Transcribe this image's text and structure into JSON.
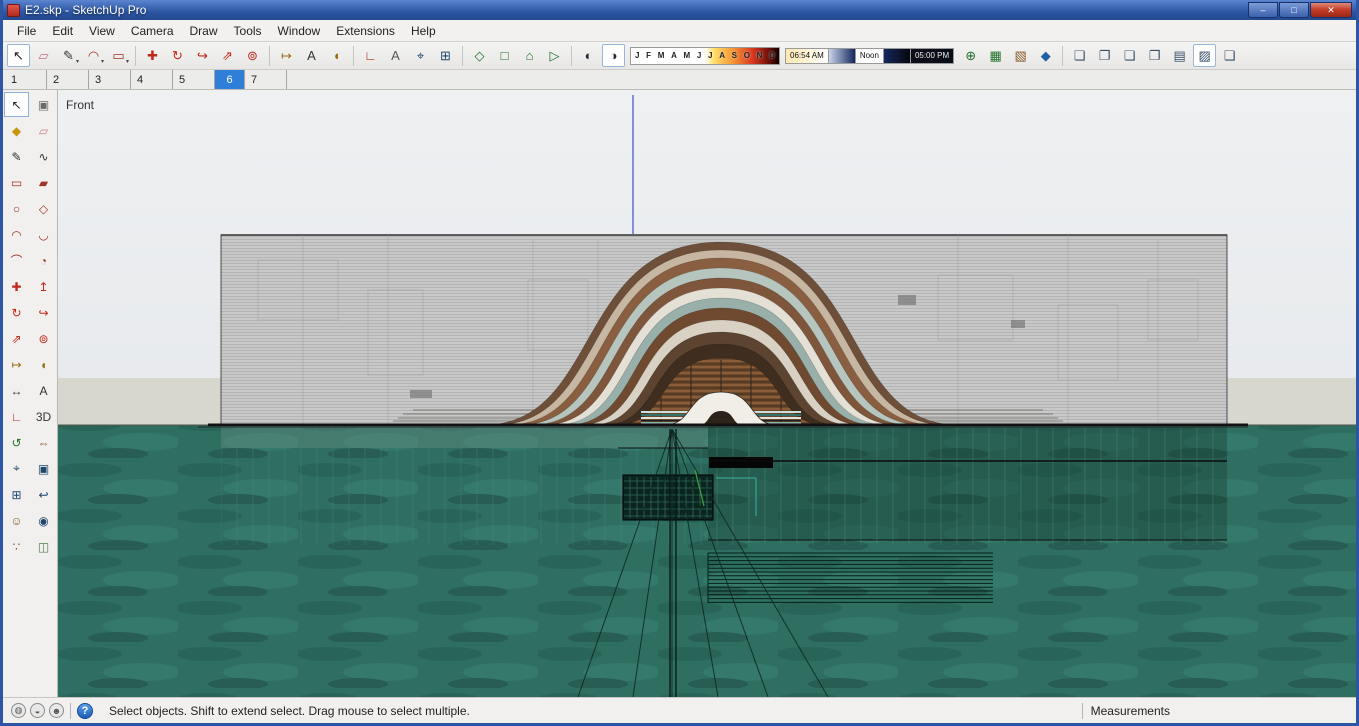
{
  "window": {
    "title": "E2.skp - SketchUp Pro",
    "controls": [
      {
        "name": "minimize-button",
        "glyph": "–"
      },
      {
        "name": "maximize-button",
        "glyph": "□"
      },
      {
        "name": "close-button",
        "glyph": "✕"
      }
    ]
  },
  "menu": {
    "items": [
      "File",
      "Edit",
      "View",
      "Camera",
      "Draw",
      "Tools",
      "Window",
      "Extensions",
      "Help"
    ]
  },
  "toolbar": {
    "groups": [
      {
        "icons": [
          {
            "name": "select-icon",
            "glyph": "↖",
            "color": "#1a1a1a",
            "active": true
          },
          {
            "name": "eraser-icon",
            "glyph": "▱",
            "color": "#c4707a"
          },
          {
            "name": "line-icon",
            "glyph": "✎",
            "color": "#333333",
            "dropdown": true
          },
          {
            "name": "arc-icon",
            "glyph": "◠",
            "color": "#a03228",
            "dropdown": true
          },
          {
            "name": "shapes-icon",
            "glyph": "▭",
            "color": "#a03228",
            "dropdown": true
          }
        ]
      },
      {
        "icons": [
          {
            "name": "move-icon",
            "glyph": "✚",
            "color": "#c02818"
          },
          {
            "name": "rotate-icon",
            "glyph": "↻",
            "color": "#c02818"
          },
          {
            "name": "follow-me-icon",
            "glyph": "↪",
            "color": "#c02818"
          },
          {
            "name": "scale-icon",
            "glyph": "⇗",
            "color": "#c02818"
          },
          {
            "name": "offset-icon",
            "glyph": "⊚",
            "color": "#c02818"
          }
        ]
      },
      {
        "icons": [
          {
            "name": "tape-measure-icon",
            "glyph": "↦",
            "color": "#9a6a14"
          },
          {
            "name": "dimension-icon",
            "glyph": "A",
            "color": "#333333"
          },
          {
            "name": "protractor-icon",
            "glyph": "◖",
            "color": "#9a6a14"
          }
        ]
      },
      {
        "icons": [
          {
            "name": "axes-icon",
            "glyph": "∟",
            "color": "#b03020"
          },
          {
            "name": "text-icon",
            "glyph": "A",
            "color": "#555555"
          },
          {
            "name": "zoom-icon",
            "glyph": "⌖",
            "color": "#20486e"
          },
          {
            "name": "zoom-extents-icon",
            "glyph": "⊞",
            "color": "#20486e"
          }
        ]
      },
      {
        "icons": [
          {
            "name": "view-iso-icon",
            "glyph": "◇",
            "color": "#20702a"
          },
          {
            "name": "view-top-icon",
            "glyph": "□",
            "color": "#20702a"
          },
          {
            "name": "view-front-icon",
            "glyph": "⌂",
            "color": "#20702a"
          },
          {
            "name": "view-right-icon",
            "glyph": "▷",
            "color": "#20702a"
          }
        ]
      },
      {
        "icons": [
          {
            "name": "shadow-settings-icon",
            "glyph": "◐",
            "color": "#22283a"
          },
          {
            "name": "shadows-toggle-icon",
            "glyph": "◑",
            "color": "#22283a",
            "active": true
          }
        ]
      }
    ],
    "shadow_controls": {
      "months": [
        "J",
        "F",
        "M",
        "A",
        "M",
        "J",
        "J",
        "A",
        "S",
        "O",
        "N",
        "D"
      ],
      "time_start": "06:54 AM",
      "time_noon": "Noon",
      "time_end": "05:00 PM"
    },
    "right_groups": [
      {
        "icons": [
          {
            "name": "add-location-icon",
            "glyph": "⊕",
            "color": "#20702a"
          },
          {
            "name": "toggle-terrain-icon",
            "glyph": "▦",
            "color": "#20702a"
          },
          {
            "name": "photo-textures-icon",
            "glyph": "▧",
            "color": "#8a5a2a"
          },
          {
            "name": "extension-warehouse-icon",
            "glyph": "◆",
            "color": "#2060a8"
          }
        ]
      },
      {
        "icons": [
          {
            "name": "page-add-icon",
            "glyph": "❏",
            "color": "#38506a"
          },
          {
            "name": "page-copy-icon",
            "glyph": "❐",
            "color": "#38506a"
          },
          {
            "name": "page-prev-icon",
            "glyph": "❏",
            "color": "#38506a"
          },
          {
            "name": "page-next-icon",
            "glyph": "❐",
            "color": "#38506a"
          },
          {
            "name": "page-list-icon",
            "glyph": "▤",
            "color": "#38506a"
          },
          {
            "name": "page-style-icon",
            "glyph": "▨",
            "color": "#38506a",
            "active": true
          },
          {
            "name": "page-settings-icon",
            "glyph": "❏",
            "color": "#38506a"
          }
        ]
      }
    ]
  },
  "scene_tabs": {
    "tabs": [
      {
        "label": "1"
      },
      {
        "label": "2"
      },
      {
        "label": "3"
      },
      {
        "label": "4"
      },
      {
        "label": "5"
      },
      {
        "label": "6",
        "selected": true
      },
      {
        "label": "7"
      }
    ]
  },
  "tool_palette": {
    "tools": [
      {
        "name": "select-tool",
        "glyph": "↖",
        "color": "#1a1a1a",
        "active": true
      },
      {
        "name": "make-component-tool",
        "glyph": "▣",
        "color": "#6b6b6b"
      },
      {
        "name": "paint-bucket-tool",
        "glyph": "◆",
        "color": "#c8960c"
      },
      {
        "name": "eraser-tool",
        "glyph": "▱",
        "color": "#d4808a"
      },
      {
        "name": "line-tool",
        "glyph": "✎",
        "color": "#333333"
      },
      {
        "name": "freehand-tool",
        "glyph": "∿",
        "color": "#333333"
      },
      {
        "name": "rectangle-tool",
        "glyph": "▭",
        "color": "#a03228"
      },
      {
        "name": "rotated-rectangle-tool",
        "glyph": "▰",
        "color": "#a03228"
      },
      {
        "name": "circle-tool",
        "glyph": "○",
        "color": "#a03228"
      },
      {
        "name": "polygon-tool",
        "glyph": "◇",
        "color": "#a03228"
      },
      {
        "name": "arc-tool",
        "glyph": "◠",
        "color": "#a03228"
      },
      {
        "name": "two-point-arc-tool",
        "glyph": "◡",
        "color": "#a03228"
      },
      {
        "name": "three-point-arc-tool",
        "glyph": "⌒",
        "color": "#a03228"
      },
      {
        "name": "pie-tool",
        "glyph": "◔",
        "color": "#a03228"
      },
      {
        "name": "move-tool",
        "glyph": "✚",
        "color": "#c02818"
      },
      {
        "name": "push-pull-tool",
        "glyph": "↥",
        "color": "#c02818"
      },
      {
        "name": "rotate-tool",
        "glyph": "↻",
        "color": "#c02818"
      },
      {
        "name": "follow-me-tool",
        "glyph": "↪",
        "color": "#c02818"
      },
      {
        "name": "scale-tool",
        "glyph": "⇗",
        "color": "#c02818"
      },
      {
        "name": "offset-tool",
        "glyph": "⊚",
        "color": "#c02818"
      },
      {
        "name": "tape-measure-tool",
        "glyph": "↦",
        "color": "#9a6a14"
      },
      {
        "name": "protractor-tool",
        "glyph": "◖",
        "color": "#9a6a14"
      },
      {
        "name": "dimension-tool",
        "glyph": "↔",
        "color": "#333333"
      },
      {
        "name": "text-tool",
        "glyph": "A",
        "color": "#333333"
      },
      {
        "name": "axes-tool",
        "glyph": "∟",
        "color": "#b03020"
      },
      {
        "name": "3d-text-tool",
        "glyph": "3D",
        "color": "#333333"
      },
      {
        "name": "orbit-tool",
        "glyph": "↺",
        "color": "#20702a"
      },
      {
        "name": "pan-tool",
        "glyph": "⇔",
        "color": "#8a6a3a"
      },
      {
        "name": "zoom-tool",
        "glyph": "⌖",
        "color": "#20486e"
      },
      {
        "name": "zoom-window-tool",
        "glyph": "▣",
        "color": "#20486e"
      },
      {
        "name": "zoom-extents-tool",
        "glyph": "⊞",
        "color": "#20486e"
      },
      {
        "name": "previous-view-tool",
        "glyph": "↩",
        "color": "#20486e"
      },
      {
        "name": "position-camera-tool",
        "glyph": "☺",
        "color": "#8a5a2a"
      },
      {
        "name": "look-around-tool",
        "glyph": "◉",
        "color": "#20486e"
      },
      {
        "name": "walk-tool",
        "glyph": "∵",
        "color": "#8a5a2a"
      },
      {
        "name": "section-plane-tool",
        "glyph": "◫",
        "color": "#567d4e"
      }
    ]
  },
  "viewport": {
    "view_label": "Front"
  },
  "status_bar": {
    "icons": [
      {
        "name": "geolocation-icon",
        "glyph": "◍"
      },
      {
        "name": "credits-icon",
        "glyph": "◒"
      },
      {
        "name": "user-icon",
        "glyph": "☻"
      }
    ],
    "help_glyph": "?",
    "hint": "Select objects. Shift to extend select. Drag mouse to select multiple.",
    "measurements_label": "Measurements",
    "measurements_value": ""
  },
  "colors": {
    "titlebar_blue": "#2c55a3",
    "selected_tab_blue": "#2f7fd9",
    "water_teal": "#2e6f62",
    "building_gray": "#c8c8c8",
    "wave_brown": "#8a5f41",
    "axis_blue": "#3a53c4"
  }
}
